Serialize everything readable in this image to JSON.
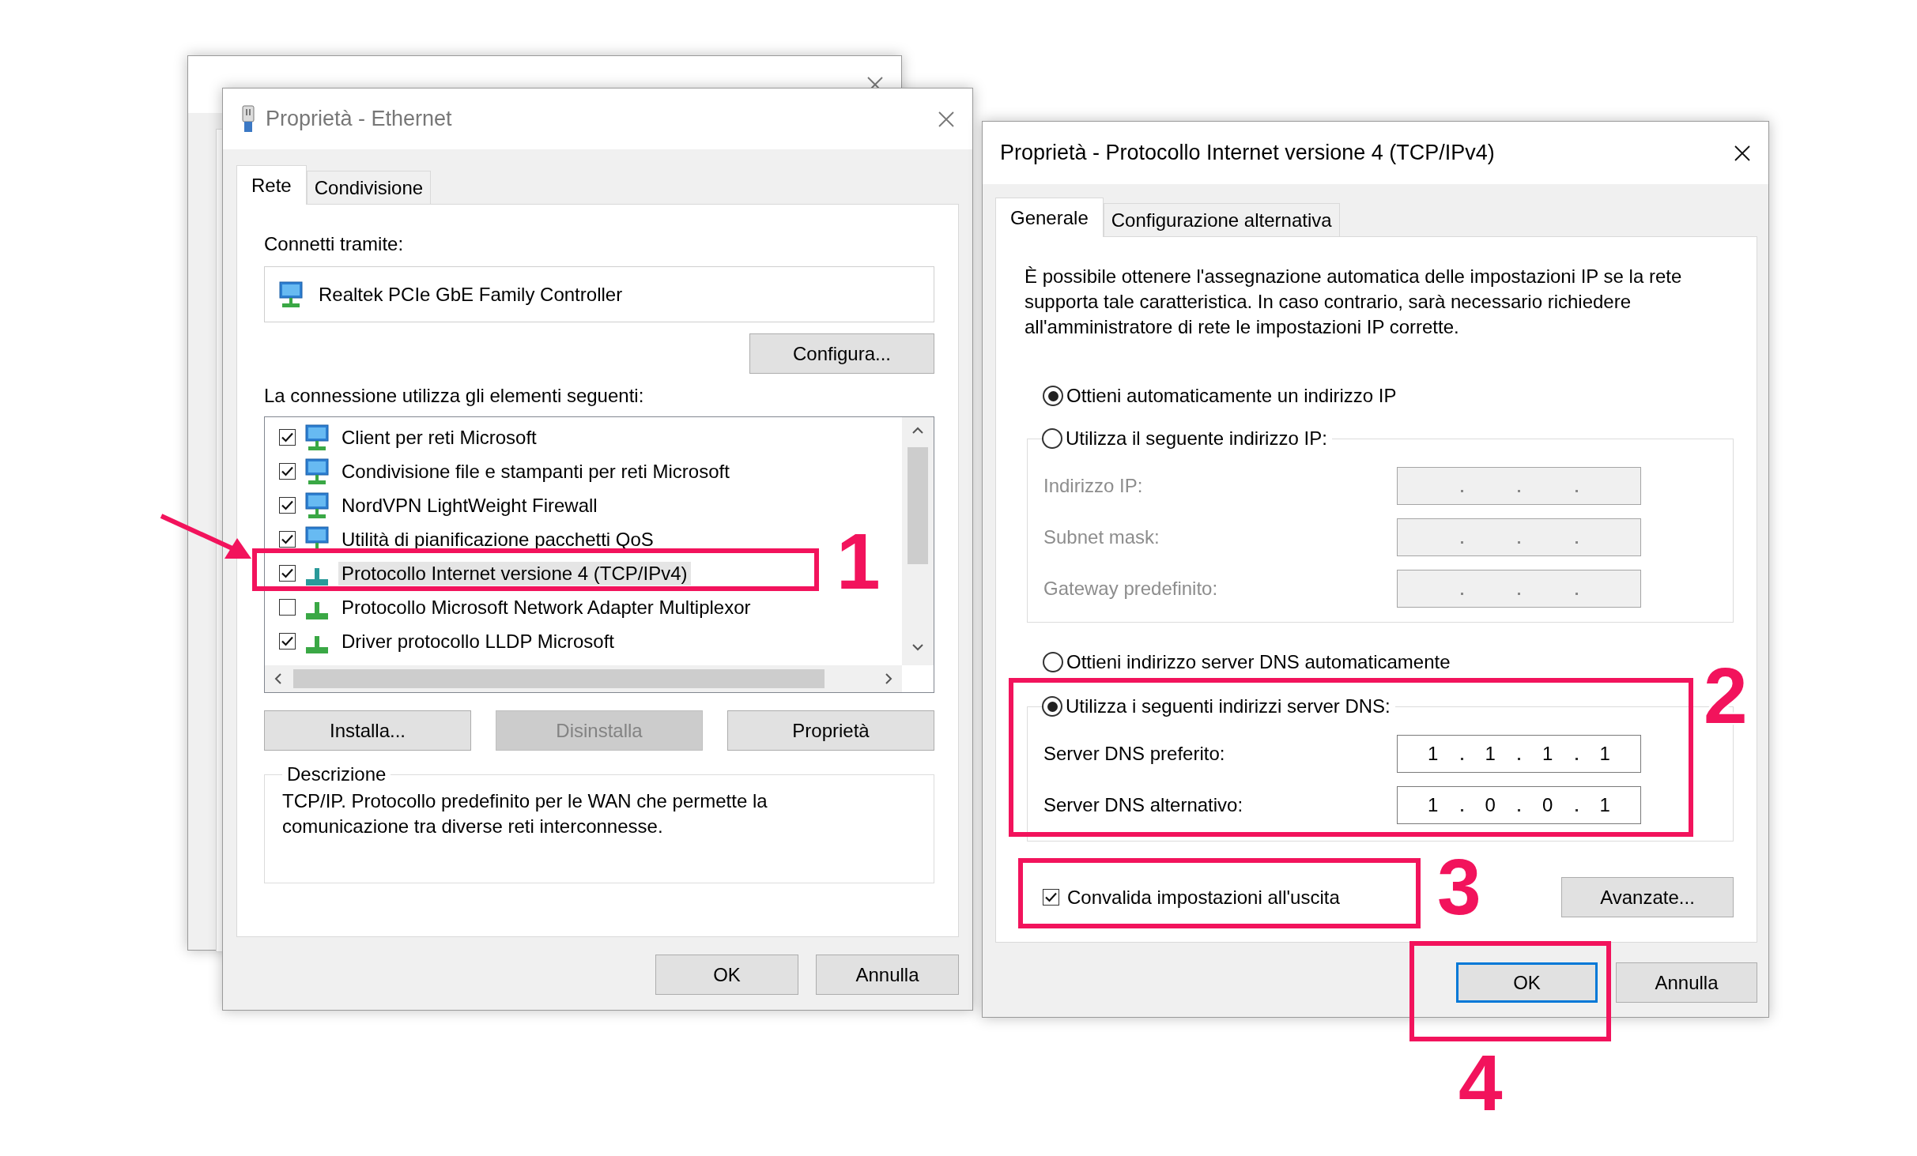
{
  "ethernet_properties": {
    "title": "Proprietà - Ethernet",
    "tabs": [
      {
        "label": "Rete",
        "selected": true
      },
      {
        "label": "Condivisione",
        "selected": false
      }
    ],
    "connect_label": "Connetti tramite:",
    "adapter": "Realtek PCIe GbE Family Controller",
    "configure_button": "Configura...",
    "items_label": "La connessione utilizza gli elementi seguenti:",
    "items": [
      {
        "label": "Client per reti Microsoft",
        "kind": "service",
        "checked": true,
        "selected": false
      },
      {
        "label": "Condivisione file e stampanti per reti Microsoft",
        "kind": "service",
        "checked": true,
        "selected": false
      },
      {
        "label": "NordVPN LightWeight Firewall",
        "kind": "service",
        "checked": true,
        "selected": false
      },
      {
        "label": "Utilità di pianificazione pacchetti QoS",
        "kind": "service",
        "checked": true,
        "selected": false
      },
      {
        "label": "Protocollo Internet versione 4 (TCP/IPv4)",
        "kind": "protocol",
        "checked": true,
        "selected": true
      },
      {
        "label": "Protocollo Microsoft Network Adapter Multiplexor",
        "kind": "protocol",
        "checked": false,
        "selected": false
      },
      {
        "label": "Driver protocollo LLDP Microsoft",
        "kind": "protocol",
        "checked": true,
        "selected": false
      }
    ],
    "item_buttons": [
      {
        "label": "Installa...",
        "disabled": false
      },
      {
        "label": "Disinstalla",
        "disabled": true
      },
      {
        "label": "Proprietà",
        "disabled": false
      }
    ],
    "description": {
      "title": "Descrizione",
      "text": "TCP/IP. Protocollo predefinito per le WAN che permette la comunicazione tra diverse reti interconnesse."
    },
    "buttons": [
      {
        "label": "OK"
      },
      {
        "label": "Annulla"
      }
    ]
  },
  "ipv4_properties": {
    "title": "Proprietà - Protocollo Internet versione 4 (TCP/IPv4)",
    "tabs": [
      {
        "label": "Generale",
        "selected": true
      },
      {
        "label": "Configurazione alternativa",
        "selected": false
      }
    ],
    "intro": "È possibile ottenere l'assegnazione automatica delle impostazioni IP se la rete supporta tale caratteristica. In caso contrario, sarà necessario richiedere all'amministratore di rete le impostazioni IP corrette.",
    "ip_options": [
      {
        "label": "Ottieni automaticamente un indirizzo IP",
        "selected": true
      },
      {
        "label": "Utilizza il seguente indirizzo IP:",
        "selected": false
      }
    ],
    "ip_fields": [
      {
        "label": "Indirizzo IP:",
        "disabled": true
      },
      {
        "label": "Subnet mask:",
        "disabled": true
      },
      {
        "label": "Gateway predefinito:",
        "disabled": true
      }
    ],
    "dns_options": [
      {
        "label": "Ottieni indirizzo server DNS automaticamente",
        "selected": false
      },
      {
        "label": "Utilizza i seguenti indirizzi server DNS:",
        "selected": true
      }
    ],
    "dns_fields": [
      {
        "label": "Server DNS preferito:",
        "disabled": false,
        "octets": [
          "1",
          "1",
          "1",
          "1"
        ]
      },
      {
        "label": "Server DNS alternativo:",
        "disabled": false,
        "octets": [
          "1",
          "0",
          "0",
          "1"
        ]
      }
    ],
    "validate": {
      "label": "Convalida impostazioni all'uscita",
      "checked": true
    },
    "advanced_button": "Avanzate...",
    "buttons": [
      {
        "label": "OK",
        "default": true
      },
      {
        "label": "Annulla",
        "default": false
      }
    ]
  },
  "annotations": [
    {
      "label": "1"
    },
    {
      "label": "2"
    },
    {
      "label": "3"
    },
    {
      "label": "4"
    }
  ]
}
